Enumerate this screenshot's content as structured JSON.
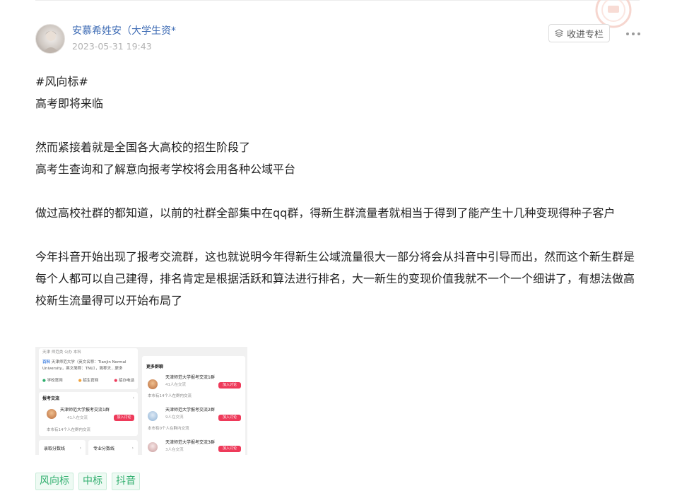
{
  "author": {
    "name": "安慕希姓安（大学生资*",
    "time": "2023-05-31 19:43"
  },
  "actions": {
    "collect_label": "收进专栏"
  },
  "content": {
    "hashtag": "#风向标#",
    "line1": "高考即将来临",
    "line2": "然而紧接着就是全国各大高校的招生阶段了",
    "line3": "高考生查询和了解意向报考学校将会用各种公域平台",
    "line4": "做过高校社群的都知道，以前的社群全部集中在qq群，得新生群流量者就相当于得到了能产生十几种变现得种子客户",
    "line5": "今年抖音开始出现了报考交流群，这也就说明今年得新生公域流量很大一部分将会从抖音中引导而出，然而这个新生群是每个人都可以自己建得，排名肯定是根据活跃和算法进行排名，大一新生的变现价值我就不一个一个细讲了，有想法做高校新生流量得可以开始布局了"
  },
  "screenshot": {
    "left_card": {
      "header": "天津 师范类 公办 本科",
      "badge": "百科",
      "desc_line1": "天津师范大学（英文名称：Tianjin Normal",
      "desc_line2": "University，英文简称：TNU），简称天…更多",
      "link1": "学校官网",
      "link2": "招生官网",
      "link3": "招办电话"
    },
    "exchange": {
      "title": "报考交流",
      "group_name": "天津师范大学报考交流1群",
      "members": "41人在交流",
      "join": "加入讨论",
      "note": "本市有14个人在群内交流"
    },
    "bottom_tabs": {
      "tab1": "录取分数线",
      "tab2": "专业分数线"
    },
    "right_card": {
      "title": "更多群聊",
      "groups": [
        {
          "name": "天津师范大学报考交流1群",
          "members": "41人在交流",
          "note": "本市有14个人在群内交流",
          "join": "加入讨论"
        },
        {
          "name": "天津师范大学报考交流2群",
          "members": "9人在交流",
          "note": "本市有0个人在群内交流",
          "join": "加入讨论"
        },
        {
          "name": "天津师范大学报考交流3群",
          "members": "3人在交流",
          "note": "",
          "join": "加入讨论"
        }
      ]
    }
  },
  "tags": [
    "风向标",
    "中标",
    "抖音"
  ],
  "colors": {
    "author_name": "#3d6bb4",
    "tag_green": "#2fae6d",
    "join_red": "#ee3a5a"
  }
}
